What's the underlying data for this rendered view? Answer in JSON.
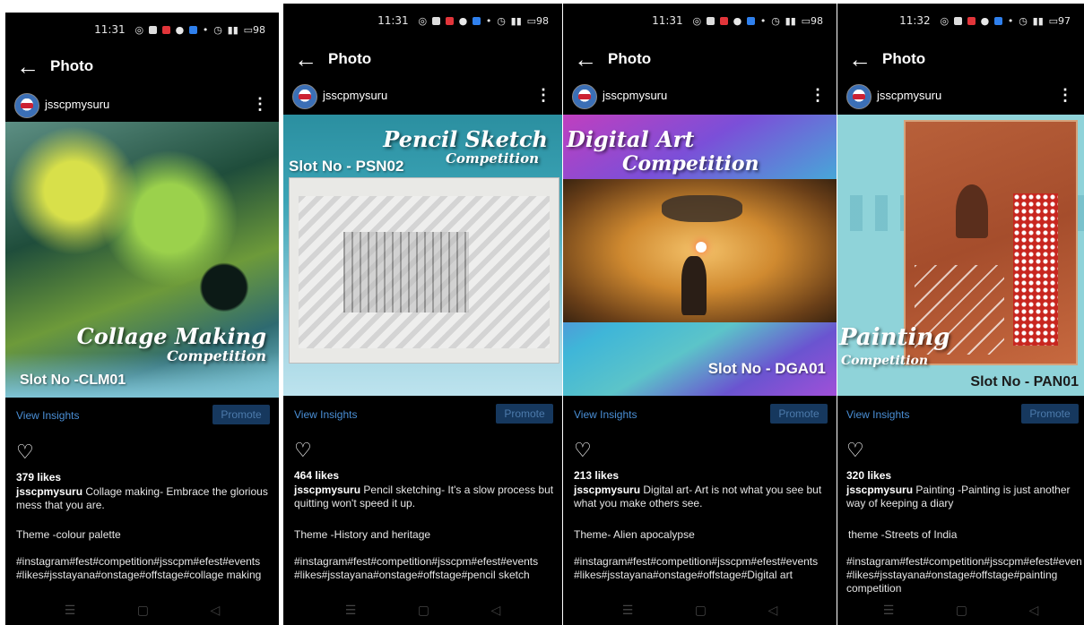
{
  "colors": {
    "link": "#4a8fd6",
    "promote_bg": "#16385e",
    "background": "#000000"
  },
  "common": {
    "title": "Photo",
    "back_icon": "←",
    "username": "jsscpmysuru",
    "more_icon": "⋮",
    "view_insights": "View Insights",
    "promote": "Promote",
    "heart_icon": "♡",
    "nav_menu_icon": "☰",
    "nav_home_icon": "▢",
    "nav_back_icon": "◁"
  },
  "panels": [
    {
      "time": "11:31",
      "battery": "98",
      "post_title_1": "Collage Making",
      "post_title_2": "Competition",
      "slot": "Slot No -CLM01",
      "likes": "379 likes",
      "caption": "Collage making- Embrace the glorious mess that you are.",
      "theme": "Theme -colour palette",
      "tags": "#instagram#fest#competition#jsscpm#efest#events #likes#jsstayana#onstage#offstage#collage making"
    },
    {
      "time": "11:31",
      "battery": "98",
      "post_title_1": "Pencil Sketch",
      "post_title_2": "Competition",
      "slot": "Slot No - PSN02",
      "likes": "464 likes",
      "caption": "Pencil sketching- It's a slow process but quitting won't speed it up.",
      "theme": "Theme -History and heritage",
      "tags": "#instagram#fest#competition#jsscpm#efest#events #likes#jsstayana#onstage#offstage#pencil sketch"
    },
    {
      "time": "11:31",
      "battery": "98",
      "post_title_1": "Digital Art",
      "post_title_2": "Competition",
      "slot": "Slot No - DGA01",
      "likes": "213 likes",
      "caption": "Digital art- Art is not what you see but what you make others see.",
      "theme": "Theme- Alien apocalypse",
      "tags": "#instagram#fest#competition#jsscpm#efest#events #likes#jsstayana#onstage#offstage#Digital art"
    },
    {
      "time": "11:32",
      "battery": "97",
      "post_title_1": "Painting",
      "post_title_2": "Competition",
      "slot": "Slot No - PAN01",
      "likes": "320 likes",
      "caption": "Painting -Painting is just another way of keeping a diary",
      "theme": "theme -Streets of India",
      "tags": "#instagram#fest#competition#jsscpm#efest#events #likes#jsstayana#onstage#offstage#painting competition"
    }
  ]
}
